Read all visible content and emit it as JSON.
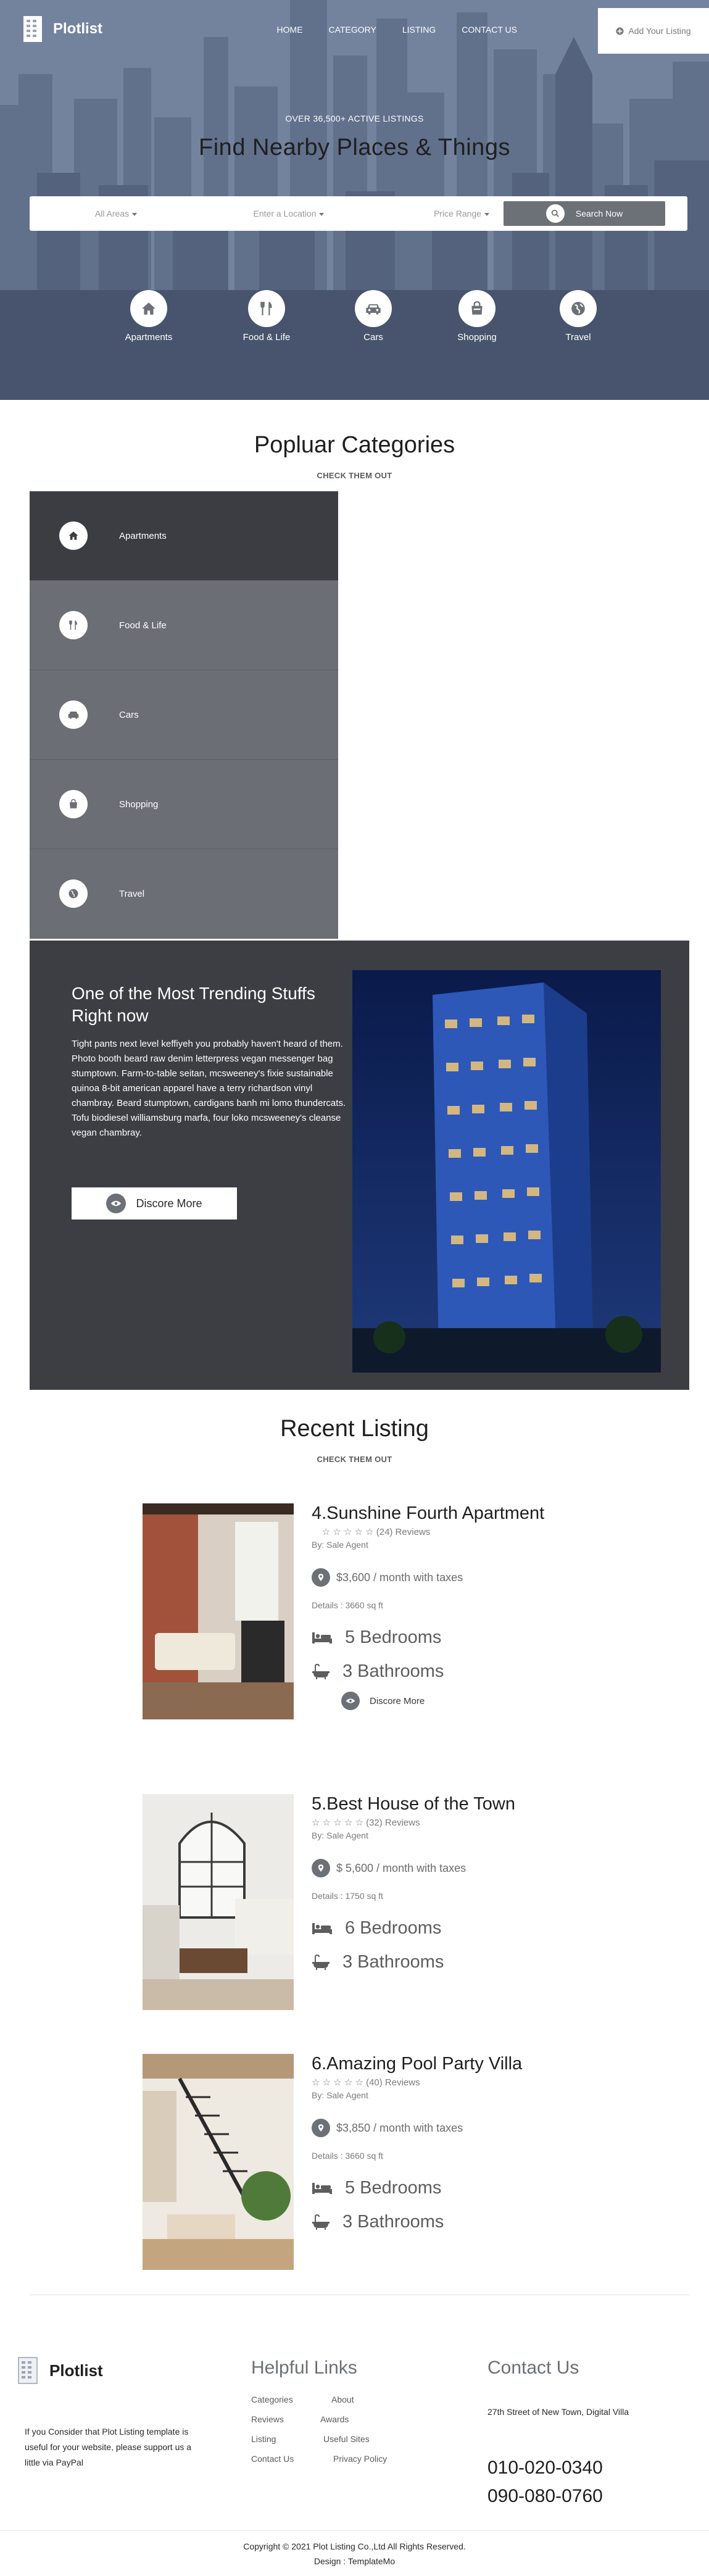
{
  "header": {
    "logo_text": "Plotlist",
    "nav": [
      "HOME",
      "CATEGORY",
      "LISTING",
      "CONTACT US"
    ],
    "add_listing": "Add Your Listing"
  },
  "hero": {
    "subtitle": "OVER 36,500+ ACTIVE LISTINGS",
    "title": "Find Nearby Places & Things",
    "search": {
      "area": "All Areas",
      "location": "Enter a Location",
      "price": "Price Range",
      "button": "Search Now"
    },
    "categories": [
      {
        "label": "Apartments",
        "icon": "home-icon"
      },
      {
        "label": "Food & Life",
        "icon": "utensils-icon"
      },
      {
        "label": "Cars",
        "icon": "car-icon"
      },
      {
        "label": "Shopping",
        "icon": "shopping-bag-icon"
      },
      {
        "label": "Travel",
        "icon": "globe-icon"
      }
    ]
  },
  "popular": {
    "title": "Popluar Categories",
    "subtitle": "CHECK THEM OUT",
    "items": [
      {
        "label": "Apartments",
        "icon": "home-icon"
      },
      {
        "label": "Food & Life",
        "icon": "utensils-icon"
      },
      {
        "label": "Cars",
        "icon": "car-icon"
      },
      {
        "label": "Shopping",
        "icon": "shopping-bag-icon"
      },
      {
        "label": "Travel",
        "icon": "globe-icon"
      }
    ]
  },
  "trending": {
    "title": "One of the Most Trending Stuffs Right now",
    "text": "Tight pants next level keffiyeh you probably haven't heard of them. Photo booth beard raw denim letterpress vegan messenger bag stumptown. Farm-to-table seitan, mcsweeney's fixie sustainable quinoa 8-bit american apparel have a terry richardson vinyl chambray. Beard stumptown, cardigans banh mi lomo thundercats. Tofu biodiesel williamsburg marfa, four loko mcsweeney's cleanse vegan chambray.",
    "button": "Discore More"
  },
  "recent": {
    "title": "Recent Listing",
    "subtitle": "CHECK THEM OUT",
    "listings": [
      {
        "title": "4.Sunshine Fourth Apartment",
        "reviews": "(24) Reviews",
        "agent": "By: Sale Agent",
        "price": "$3,600 / month with taxes",
        "details": "Details : 3660 sq ft",
        "bedrooms": "5 Bedrooms",
        "bathrooms": "3 Bathrooms",
        "more": "Discore More"
      },
      {
        "title": "5.Best House of the Town",
        "reviews": "(32) Reviews",
        "agent": "By: Sale Agent",
        "price": "$ 5,600 / month with taxes",
        "details": "Details : 1750 sq ft",
        "bedrooms": "6 Bedrooms",
        "bathrooms": "3 Bathrooms"
      },
      {
        "title": "6.Amazing Pool Party Villa",
        "reviews": "(40) Reviews",
        "agent": "By: Sale Agent",
        "price": "$3,850 / month with taxes",
        "details": "Details : 3660 sq ft",
        "bedrooms": "5 Bedrooms",
        "bathrooms": "3 Bathrooms"
      }
    ]
  },
  "footer": {
    "logo_text": "Plotlist",
    "about": "If you Consider that Plot Listing template is useful for your website, please support us a little via PayPal",
    "links_title": "Helpful Links",
    "links": [
      "Categories",
      "About",
      "Reviews",
      "Awards",
      "Listing",
      "Useful Sites",
      "Contact Us",
      "Privacy Policy"
    ],
    "contact_title": "Contact Us",
    "address": "27th Street of New Town, Digital Villa",
    "phone1": "010-020-0340",
    "phone2": "090-080-0760",
    "copyright": "Copyright © 2021 Plot Listing Co.,Ltd All Rights Reserved.",
    "design": "Design : TemplateMo"
  },
  "colors": {
    "accent": "#6c7077",
    "dark": "#3c3e43",
    "category": "#6b6e74"
  }
}
